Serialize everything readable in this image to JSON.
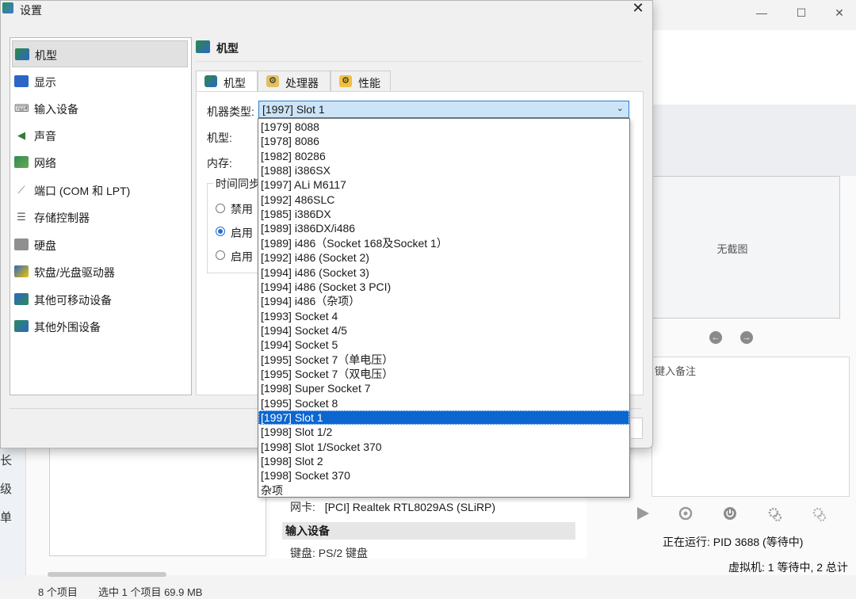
{
  "dialog": {
    "title": "设置",
    "close_glyph": "✕",
    "categories": [
      {
        "label": "机型",
        "selected": true
      },
      {
        "label": "显示"
      },
      {
        "label": "输入设备"
      },
      {
        "label": "声音"
      },
      {
        "label": "网络"
      },
      {
        "label": "端口 (COM 和 LPT)"
      },
      {
        "label": "存储控制器"
      },
      {
        "label": "硬盘"
      },
      {
        "label": "软盘/光盘驱动器"
      },
      {
        "label": "其他可移动设备"
      },
      {
        "label": "其他外围设备"
      }
    ],
    "page_title": "机型",
    "tabs": [
      {
        "label": "机型",
        "active": true
      },
      {
        "label": "处理器"
      },
      {
        "label": "性能"
      }
    ],
    "fields": {
      "machine_type_label": "机器类型:",
      "machine_type_value": "[1997] Slot 1",
      "machine_label": "机型:",
      "memory_label": "内存:",
      "timesync_label": "时间同步",
      "radio_disable": "禁用",
      "radio_enable_1": "启用",
      "radio_enable_2": "启用"
    },
    "dropdown_options": [
      "[1979] 8088",
      "[1978] 8086",
      "[1982] 80286",
      "[1988] i386SX",
      "[1997] ALi M6117",
      "[1992] 486SLC",
      "[1985] i386DX",
      "[1989] i386DX/i486",
      "[1989] i486（Socket 168及Socket 1）",
      "[1992] i486 (Socket 2)",
      "[1994] i486 (Socket 3)",
      "[1994] i486 (Socket 3 PCI)",
      "[1994] i486（杂项）",
      "[1993] Socket 4",
      "[1994] Socket 4/5",
      "[1994] Socket 5",
      "[1995] Socket 7（单电压）",
      "[1995] Socket 7（双电压）",
      "[1998] Super Socket 7",
      "[1995] Socket 8",
      "[1997] Slot 1",
      "[1998] Slot 1/2",
      "[1998] Slot 1/Socket 370",
      "[1998] Slot 2",
      "[1998] Socket 370",
      "杂项"
    ],
    "selected_option": "[1997] Slot 1"
  },
  "manager": {
    "no_screenshot": "无截图",
    "notes_placeholder": "键入备注",
    "nic_label": "网卡:",
    "nic_value": "[PCI] Realtek RTL8029AS (SLiRP)",
    "input_section": "输入设备",
    "keyboard_text": "键盘:  PS/2 键盘",
    "running_status": "正在运行: PID 3688 (等待中)",
    "vm_count": "虚拟机: 1 等待中, 2 总计",
    "win_min": "—",
    "win_max": "☐",
    "win_close": "✕",
    "nav_prev": "←",
    "nav_next": "→"
  },
  "explorer": {
    "side_letters": [
      "长",
      "级",
      "单"
    ],
    "item_count": "8 个项目",
    "selection": "选中 1 个项目  69.9 MB"
  },
  "colors": {
    "selection_blue": "#0b66d0",
    "combo_highlight": "#cce4f7",
    "radio_blue": "#1f6fd3"
  }
}
